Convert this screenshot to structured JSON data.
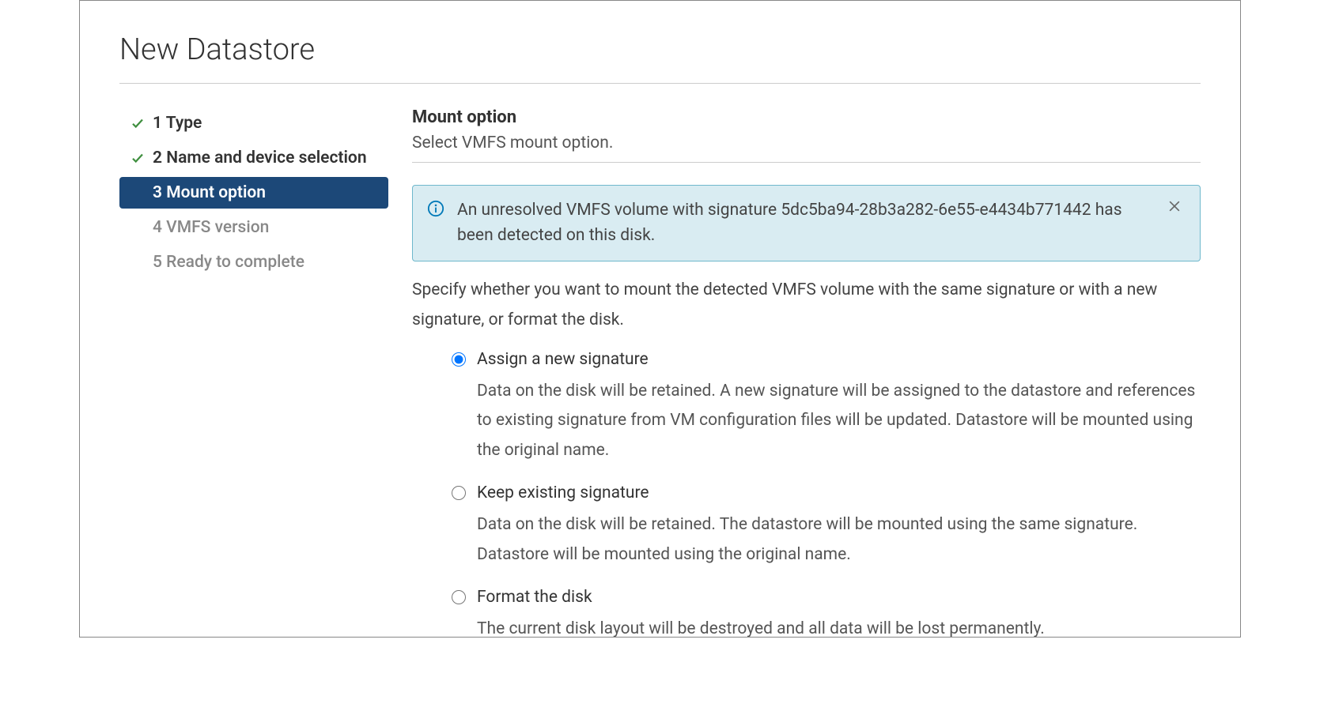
{
  "dialog": {
    "title": "New Datastore"
  },
  "steps": [
    {
      "num": "1",
      "label": "Type",
      "state": "completed"
    },
    {
      "num": "2",
      "label": "Name and device selection",
      "state": "completed"
    },
    {
      "num": "3",
      "label": "Mount option",
      "state": "active"
    },
    {
      "num": "4",
      "label": "VMFS version",
      "state": "pending"
    },
    {
      "num": "5",
      "label": "Ready to complete",
      "state": "pending"
    }
  ],
  "section": {
    "title": "Mount option",
    "subtitle": "Select VMFS mount option."
  },
  "alert": {
    "text": "An unresolved VMFS volume with signature 5dc5ba94-28b3a282-6e55-e4434b771442 has been detected on this disk."
  },
  "description": "Specify whether you want to mount the detected VMFS volume with the same signature or with a new signature, or format the disk.",
  "options": [
    {
      "id": "assign-new",
      "label": "Assign a new signature",
      "desc": "Data on the disk will be retained. A new signature will be assigned to the datastore and references to existing signature from VM configuration files will be updated. Datastore will be mounted using the original name.",
      "checked": true
    },
    {
      "id": "keep-existing",
      "label": "Keep existing signature",
      "desc": "Data on the disk will be retained. The datastore will be mounted using the same signature. Datastore will be mounted using the original name.",
      "checked": false
    },
    {
      "id": "format",
      "label": "Format the disk",
      "desc": "The current disk layout will be destroyed and all data will be lost permanently.",
      "checked": false
    }
  ]
}
